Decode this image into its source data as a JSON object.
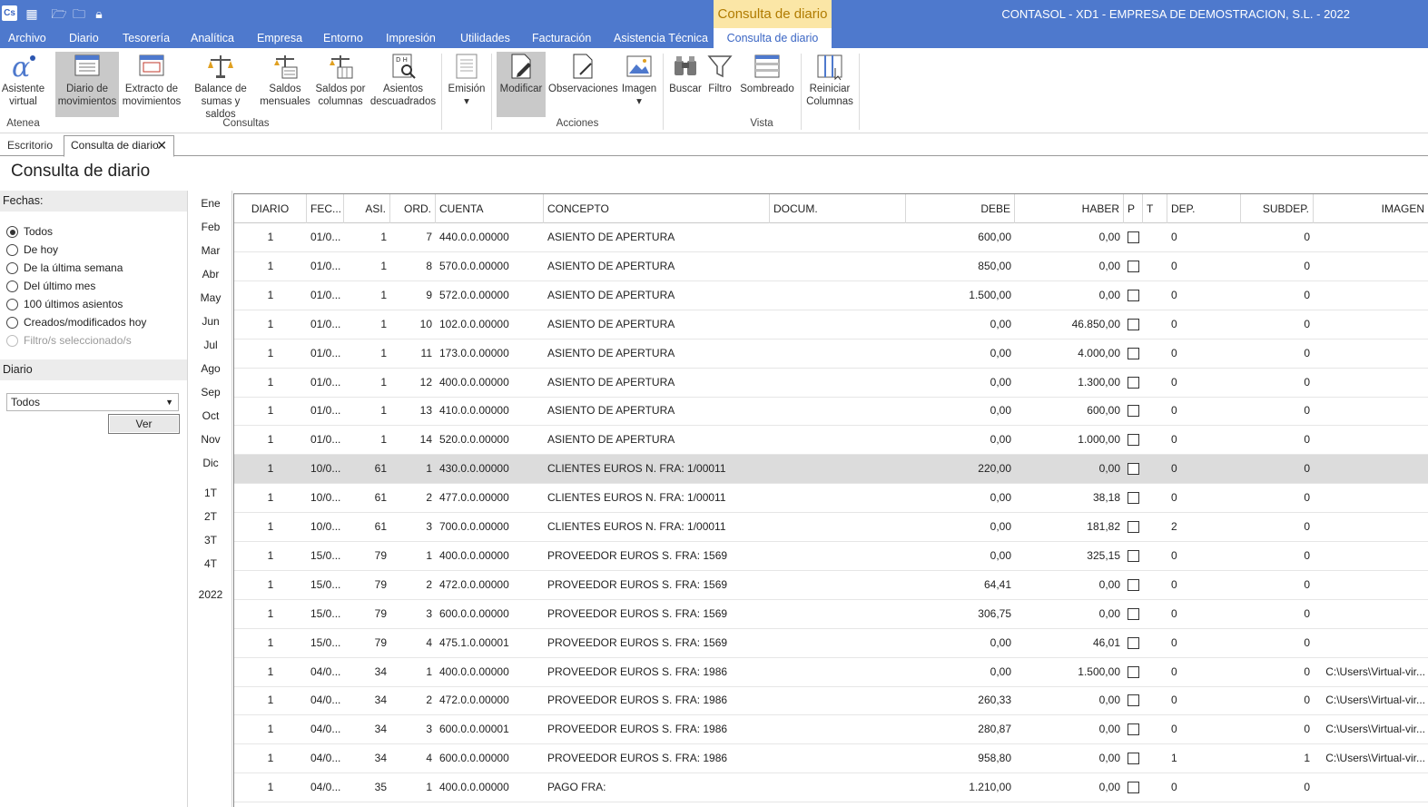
{
  "app": {
    "icon_label": "Cs",
    "context_title": "Consulta de diario",
    "window_title": "CONTASOL - XD1 - EMPRESA DE DEMOSTRACION, S.L. - 2022"
  },
  "menu": [
    "Archivo",
    "Diario",
    "Tesorería",
    "Analítica",
    "Empresa",
    "Entorno",
    "Impresión",
    "Utilidades",
    "Facturación",
    "Asistencia Técnica"
  ],
  "menu_active": "Consulta de diario",
  "ribbon": {
    "buttons": [
      {
        "l1": "Asistente",
        "l2": "virtual"
      },
      {
        "l1": "Diario de",
        "l2": "movimientos"
      },
      {
        "l1": "Extracto de",
        "l2": "movimientos"
      },
      {
        "l1": "Balance de",
        "l2": "sumas y saldos"
      },
      {
        "l1": "Saldos",
        "l2": "mensuales"
      },
      {
        "l1": "Saldos por",
        "l2": "columnas"
      },
      {
        "l1": "Asientos",
        "l2": "descuadrados"
      },
      {
        "l1": "Emisión",
        "l2": "▾"
      },
      {
        "l1": "Modificar",
        "l2": ""
      },
      {
        "l1": "Observaciones",
        "l2": ""
      },
      {
        "l1": "Imagen",
        "l2": "▾"
      },
      {
        "l1": "Buscar",
        "l2": ""
      },
      {
        "l1": "Filtro",
        "l2": ""
      },
      {
        "l1": "Sombreado",
        "l2": ""
      },
      {
        "l1": "Reiniciar",
        "l2": "Columnas"
      }
    ],
    "groups": [
      "Atenea",
      "Consultas",
      "Acciones",
      "Vista"
    ]
  },
  "tabs": {
    "escritorio": "Escritorio",
    "active": "Consulta de diario",
    "close": "✕"
  },
  "page_title": "Consulta de diario",
  "filters": {
    "fechas_label": "Fechas:",
    "options": [
      "Todos",
      "De hoy",
      "De la última semana",
      "Del último mes",
      "100 últimos asientos",
      "Creados/modificados hoy",
      "Filtro/s seleccionado/s"
    ],
    "diario_label": "Diario",
    "diario_value": "Todos",
    "ver_label": "Ver"
  },
  "months": [
    "Ene",
    "Feb",
    "Mar",
    "Abr",
    "May",
    "Jun",
    "Jul",
    "Ago",
    "Sep",
    "Oct",
    "Nov",
    "Dic"
  ],
  "quarters": [
    "1T",
    "2T",
    "3T",
    "4T"
  ],
  "year": "2022",
  "columns": [
    "DIARIO",
    "FEC...",
    "ASI.",
    "ORD.",
    "CUENTA",
    "CONCEPTO",
    "DOCUM.",
    "DEBE",
    "HABER",
    "P",
    "T",
    "DEP.",
    "SUBDEP.",
    "IMAGEN"
  ],
  "rows": [
    [
      "1",
      "01/0...",
      "1",
      "7",
      "440.0.0.00000",
      "ASIENTO DE APERTURA",
      "",
      "600,00",
      "0,00",
      "",
      "",
      "0",
      "0",
      ""
    ],
    [
      "1",
      "01/0...",
      "1",
      "8",
      "570.0.0.00000",
      "ASIENTO DE APERTURA",
      "",
      "850,00",
      "0,00",
      "",
      "",
      "0",
      "0",
      ""
    ],
    [
      "1",
      "01/0...",
      "1",
      "9",
      "572.0.0.00000",
      "ASIENTO DE APERTURA",
      "",
      "1.500,00",
      "0,00",
      "",
      "",
      "0",
      "0",
      ""
    ],
    [
      "1",
      "01/0...",
      "1",
      "10",
      "102.0.0.00000",
      "ASIENTO DE APERTURA",
      "",
      "0,00",
      "46.850,00",
      "",
      "",
      "0",
      "0",
      ""
    ],
    [
      "1",
      "01/0...",
      "1",
      "11",
      "173.0.0.00000",
      "ASIENTO DE APERTURA",
      "",
      "0,00",
      "4.000,00",
      "",
      "",
      "0",
      "0",
      ""
    ],
    [
      "1",
      "01/0...",
      "1",
      "12",
      "400.0.0.00000",
      "ASIENTO DE APERTURA",
      "",
      "0,00",
      "1.300,00",
      "",
      "",
      "0",
      "0",
      ""
    ],
    [
      "1",
      "01/0...",
      "1",
      "13",
      "410.0.0.00000",
      "ASIENTO DE APERTURA",
      "",
      "0,00",
      "600,00",
      "",
      "",
      "0",
      "0",
      ""
    ],
    [
      "1",
      "01/0...",
      "1",
      "14",
      "520.0.0.00000",
      "ASIENTO DE APERTURA",
      "",
      "0,00",
      "1.000,00",
      "",
      "",
      "0",
      "0",
      ""
    ],
    [
      "1",
      "10/0...",
      "61",
      "1",
      "430.0.0.00000",
      "CLIENTES EUROS N. FRA:  1/00011",
      "",
      "220,00",
      "0,00",
      "",
      "",
      "0",
      "0",
      ""
    ],
    [
      "1",
      "10/0...",
      "61",
      "2",
      "477.0.0.00000",
      "CLIENTES EUROS N. FRA:  1/00011",
      "",
      "0,00",
      "38,18",
      "",
      "",
      "0",
      "0",
      ""
    ],
    [
      "1",
      "10/0...",
      "61",
      "3",
      "700.0.0.00000",
      "CLIENTES EUROS N. FRA:  1/00011",
      "",
      "0,00",
      "181,82",
      "",
      "",
      "2",
      "0",
      ""
    ],
    [
      "1",
      "15/0...",
      "79",
      "1",
      "400.0.0.00000",
      "PROVEEDOR EUROS S. FRA:  1569",
      "",
      "0,00",
      "325,15",
      "",
      "",
      "0",
      "0",
      ""
    ],
    [
      "1",
      "15/0...",
      "79",
      "2",
      "472.0.0.00000",
      "PROVEEDOR EUROS S. FRA:  1569",
      "",
      "64,41",
      "0,00",
      "",
      "",
      "0",
      "0",
      ""
    ],
    [
      "1",
      "15/0...",
      "79",
      "3",
      "600.0.0.00000",
      "PROVEEDOR EUROS S. FRA:  1569",
      "",
      "306,75",
      "0,00",
      "",
      "",
      "0",
      "0",
      ""
    ],
    [
      "1",
      "15/0...",
      "79",
      "4",
      "475.1.0.00001",
      "PROVEEDOR EUROS S. FRA:  1569",
      "",
      "0,00",
      "46,01",
      "",
      "",
      "0",
      "0",
      ""
    ],
    [
      "1",
      "04/0...",
      "34",
      "1",
      "400.0.0.00000",
      "PROVEEDOR EUROS S. FRA:  1986",
      "",
      "0,00",
      "1.500,00",
      "",
      "",
      "0",
      "0",
      "C:\\Users\\Virtual-vir..."
    ],
    [
      "1",
      "04/0...",
      "34",
      "2",
      "472.0.0.00000",
      "PROVEEDOR EUROS S. FRA:  1986",
      "",
      "260,33",
      "0,00",
      "",
      "",
      "0",
      "0",
      "C:\\Users\\Virtual-vir..."
    ],
    [
      "1",
      "04/0...",
      "34",
      "3",
      "600.0.0.00001",
      "PROVEEDOR EUROS S. FRA:  1986",
      "",
      "280,87",
      "0,00",
      "",
      "",
      "0",
      "0",
      "C:\\Users\\Virtual-vir..."
    ],
    [
      "1",
      "04/0...",
      "34",
      "4",
      "600.0.0.00000",
      "PROVEEDOR EUROS S. FRA:  1986",
      "",
      "958,80",
      "0,00",
      "",
      "",
      "1",
      "1",
      "C:\\Users\\Virtual-vir..."
    ],
    [
      "1",
      "04/0...",
      "35",
      "1",
      "400.0.0.00000",
      "PAGO FRA:",
      "",
      "1.210,00",
      "0,00",
      "",
      "",
      "0",
      "0",
      ""
    ]
  ],
  "selected_row": 8,
  "colors": {
    "titlebar": "#4e79cd",
    "context_tab": "#fbe6a6",
    "selected_row": "#dcdcdc"
  }
}
